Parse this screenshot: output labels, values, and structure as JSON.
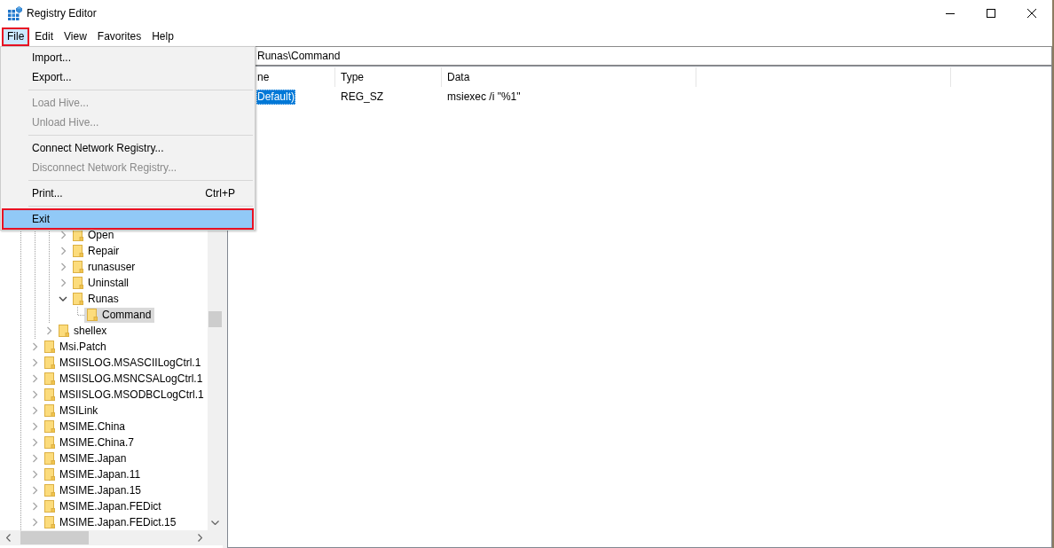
{
  "window": {
    "title": "Registry Editor"
  },
  "menu_bar": [
    {
      "label": "File",
      "highlighted": true
    },
    {
      "label": "Edit",
      "highlighted": false
    },
    {
      "label": "View",
      "highlighted": false
    },
    {
      "label": "Favorites",
      "highlighted": false
    },
    {
      "label": "Help",
      "highlighted": false
    }
  ],
  "file_menu": {
    "items": [
      {
        "kind": "item",
        "label": "Import...",
        "disabled": false,
        "highlighted": false
      },
      {
        "kind": "item",
        "label": "Export...",
        "disabled": false,
        "highlighted": false
      },
      {
        "kind": "separator"
      },
      {
        "kind": "item",
        "label": "Load Hive...",
        "disabled": true,
        "highlighted": false
      },
      {
        "kind": "item",
        "label": "Unload Hive...",
        "disabled": true,
        "highlighted": false
      },
      {
        "kind": "separator"
      },
      {
        "kind": "item",
        "label": "Connect Network Registry...",
        "disabled": false,
        "highlighted": false
      },
      {
        "kind": "item",
        "label": "Disconnect Network Registry...",
        "disabled": true,
        "highlighted": false
      },
      {
        "kind": "separator"
      },
      {
        "kind": "item",
        "label": "Print...",
        "shortcut": "Ctrl+P",
        "disabled": false,
        "highlighted": false
      },
      {
        "kind": "separator"
      },
      {
        "kind": "item",
        "label": "Exit",
        "disabled": false,
        "highlighted": true
      }
    ]
  },
  "address_bar": {
    "value": "Runas\\Command"
  },
  "tree": {
    "items": [
      {
        "children": [
          {
            "children": [
              {
                "label": "Open",
                "expanded": false,
                "selected": false
              },
              {
                "label": "Repair",
                "expanded": false,
                "selected": false
              },
              {
                "label": "runasuser",
                "expanded": false,
                "selected": false
              },
              {
                "label": "Uninstall",
                "expanded": false,
                "selected": false
              },
              {
                "label": "Runas",
                "expanded": true,
                "selected": false,
                "children": [
                  {
                    "label": "Command",
                    "selected": true
                  }
                ]
              }
            ]
          },
          {
            "label": "shellex",
            "expanded": false,
            "selected": false
          }
        ]
      },
      {
        "label": "Msi.Patch",
        "expanded": false,
        "selected": false
      },
      {
        "label": "MSIISLOG.MSASCIILogCtrl.1",
        "expanded": false,
        "selected": false
      },
      {
        "label": "MSIISLOG.MSNCSALogCtrl.1",
        "expanded": false,
        "selected": false
      },
      {
        "label": "MSIISLOG.MSODBCLogCtrl.1",
        "expanded": false,
        "selected": false
      },
      {
        "label": "MSILink",
        "expanded": false,
        "selected": false
      },
      {
        "label": "MSIME.China",
        "expanded": false,
        "selected": false
      },
      {
        "label": "MSIME.China.7",
        "expanded": false,
        "selected": false
      },
      {
        "label": "MSIME.Japan",
        "expanded": false,
        "selected": false
      },
      {
        "label": "MSIME.Japan.11",
        "expanded": false,
        "selected": false
      },
      {
        "label": "MSIME.Japan.15",
        "expanded": false,
        "selected": false
      },
      {
        "label": "MSIME.Japan.FEDict",
        "expanded": false,
        "selected": false
      },
      {
        "label": "MSIME.Japan.FEDict.15",
        "expanded": false,
        "selected": false
      }
    ]
  },
  "values_table": {
    "columns": [
      "ne",
      "Type",
      "Data"
    ],
    "rows": [
      {
        "name": "Default)",
        "type": "REG_SZ",
        "data": "msiexec /i \"%1\"",
        "selected": true
      }
    ]
  }
}
